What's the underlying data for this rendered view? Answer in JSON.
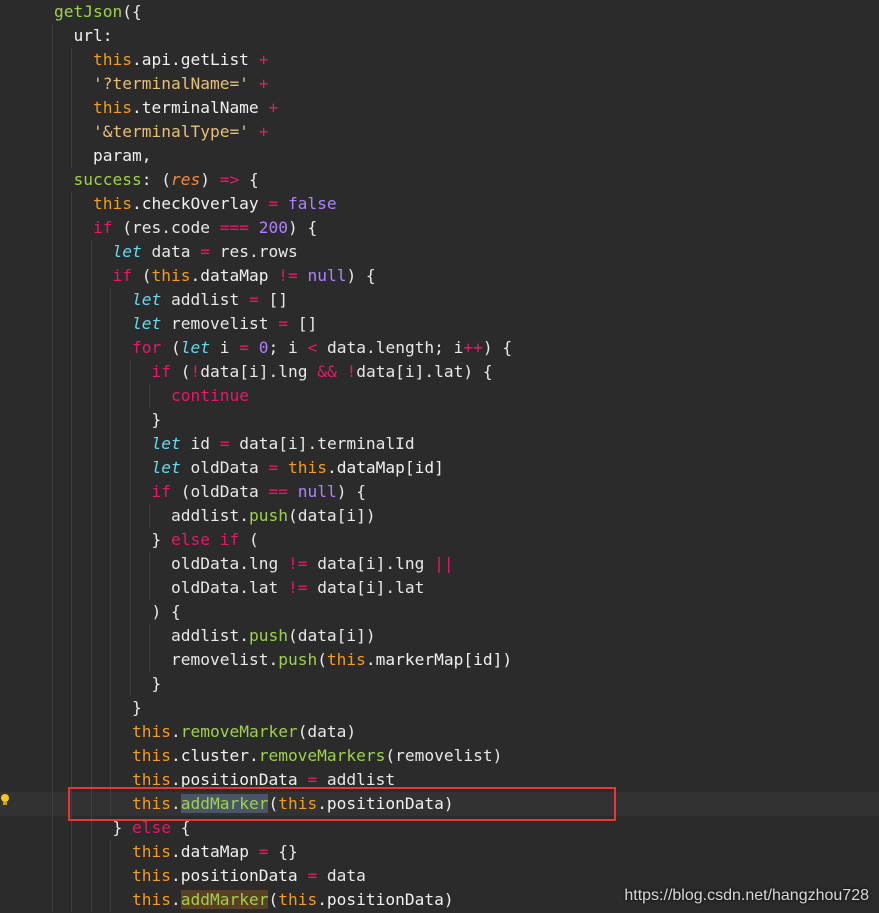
{
  "code_lines": [
    {
      "indent": 1,
      "tokens": [
        [
          "fn",
          "getJson"
        ],
        [
          "plain",
          "({"
        ]
      ]
    },
    {
      "indent": 2,
      "tokens": [
        [
          "prop",
          "url:"
        ]
      ]
    },
    {
      "indent": 3,
      "tokens": [
        [
          "obj",
          "this"
        ],
        [
          "prop",
          ".api.getList "
        ],
        [
          "op",
          "+"
        ]
      ]
    },
    {
      "indent": 3,
      "tokens": [
        [
          "str",
          "'?terminalName='"
        ],
        [
          "plain",
          " "
        ],
        [
          "op",
          "+"
        ]
      ]
    },
    {
      "indent": 3,
      "tokens": [
        [
          "obj",
          "this"
        ],
        [
          "prop",
          ".terminalName "
        ],
        [
          "op",
          "+"
        ]
      ]
    },
    {
      "indent": 3,
      "tokens": [
        [
          "str",
          "'&terminalType='"
        ],
        [
          "plain",
          " "
        ],
        [
          "op",
          "+"
        ]
      ]
    },
    {
      "indent": 3,
      "tokens": [
        [
          "prop",
          "param,"
        ]
      ]
    },
    {
      "indent": 2,
      "tokens": [
        [
          "fn",
          "success"
        ],
        [
          "plain",
          ": ("
        ],
        [
          "arg",
          "res"
        ],
        [
          "plain",
          ") "
        ],
        [
          "op",
          "=>"
        ],
        [
          "plain",
          " {"
        ]
      ]
    },
    {
      "indent": 3,
      "tokens": [
        [
          "obj",
          "this"
        ],
        [
          "prop",
          ".checkOverlay "
        ],
        [
          "op",
          "="
        ],
        [
          "plain",
          " "
        ],
        [
          "bool",
          "false"
        ]
      ]
    },
    {
      "indent": 3,
      "tokens": [
        [
          "kw",
          "if"
        ],
        [
          "plain",
          " (res.code "
        ],
        [
          "op",
          "==="
        ],
        [
          "plain",
          " "
        ],
        [
          "num",
          "200"
        ],
        [
          "plain",
          ") {"
        ]
      ]
    },
    {
      "indent": 4,
      "tokens": [
        [
          "let",
          "let"
        ],
        [
          "plain",
          " data "
        ],
        [
          "op",
          "="
        ],
        [
          "plain",
          " res.rows"
        ]
      ]
    },
    {
      "indent": 4,
      "tokens": [
        [
          "kw",
          "if"
        ],
        [
          "plain",
          " ("
        ],
        [
          "obj",
          "this"
        ],
        [
          "prop",
          ".dataMap "
        ],
        [
          "op",
          "!="
        ],
        [
          "plain",
          " "
        ],
        [
          "bool",
          "null"
        ],
        [
          "plain",
          ") {"
        ]
      ]
    },
    {
      "indent": 5,
      "tokens": [
        [
          "let",
          "let"
        ],
        [
          "plain",
          " addlist "
        ],
        [
          "op",
          "="
        ],
        [
          "plain",
          " []"
        ]
      ]
    },
    {
      "indent": 5,
      "tokens": [
        [
          "let",
          "let"
        ],
        [
          "plain",
          " removelist "
        ],
        [
          "op",
          "="
        ],
        [
          "plain",
          " []"
        ]
      ]
    },
    {
      "indent": 5,
      "tokens": [
        [
          "kw",
          "for"
        ],
        [
          "plain",
          " ("
        ],
        [
          "let",
          "let"
        ],
        [
          "plain",
          " i "
        ],
        [
          "op",
          "="
        ],
        [
          "plain",
          " "
        ],
        [
          "num",
          "0"
        ],
        [
          "plain",
          "; i "
        ],
        [
          "op",
          "<"
        ],
        [
          "plain",
          " data.length; i"
        ],
        [
          "op",
          "++"
        ],
        [
          "plain",
          ") {"
        ]
      ]
    },
    {
      "indent": 6,
      "tokens": [
        [
          "kw",
          "if"
        ],
        [
          "plain",
          " ("
        ],
        [
          "op",
          "!"
        ],
        [
          "plain",
          "data[i].lng "
        ],
        [
          "op",
          "&&"
        ],
        [
          "plain",
          " "
        ],
        [
          "op",
          "!"
        ],
        [
          "plain",
          "data[i].lat) {"
        ]
      ]
    },
    {
      "indent": 7,
      "tokens": [
        [
          "kw",
          "continue"
        ]
      ]
    },
    {
      "indent": 6,
      "tokens": [
        [
          "plain",
          "}"
        ]
      ]
    },
    {
      "indent": 6,
      "tokens": [
        [
          "let",
          "let"
        ],
        [
          "plain",
          " id "
        ],
        [
          "op",
          "="
        ],
        [
          "plain",
          " data[i].terminalId"
        ]
      ]
    },
    {
      "indent": 6,
      "tokens": [
        [
          "let",
          "let"
        ],
        [
          "plain",
          " oldData "
        ],
        [
          "op",
          "="
        ],
        [
          "plain",
          " "
        ],
        [
          "obj",
          "this"
        ],
        [
          "prop",
          ".dataMap[id]"
        ]
      ]
    },
    {
      "indent": 6,
      "tokens": [
        [
          "kw",
          "if"
        ],
        [
          "plain",
          " (oldData "
        ],
        [
          "op",
          "=="
        ],
        [
          "plain",
          " "
        ],
        [
          "bool",
          "null"
        ],
        [
          "plain",
          ") {"
        ]
      ]
    },
    {
      "indent": 7,
      "tokens": [
        [
          "plain",
          "addlist."
        ],
        [
          "fn",
          "push"
        ],
        [
          "plain",
          "(data[i])"
        ]
      ]
    },
    {
      "indent": 6,
      "tokens": [
        [
          "plain",
          "} "
        ],
        [
          "kw",
          "else if"
        ],
        [
          "plain",
          " ("
        ]
      ]
    },
    {
      "indent": 7,
      "tokens": [
        [
          "plain",
          "oldData.lng "
        ],
        [
          "op",
          "!="
        ],
        [
          "plain",
          " data[i].lng "
        ],
        [
          "op",
          "||"
        ]
      ]
    },
    {
      "indent": 7,
      "tokens": [
        [
          "plain",
          "oldData.lat "
        ],
        [
          "op",
          "!="
        ],
        [
          "plain",
          " data[i].lat"
        ]
      ]
    },
    {
      "indent": 6,
      "tokens": [
        [
          "plain",
          ") {"
        ]
      ]
    },
    {
      "indent": 7,
      "tokens": [
        [
          "plain",
          "addlist."
        ],
        [
          "fn",
          "push"
        ],
        [
          "plain",
          "(data[i])"
        ]
      ]
    },
    {
      "indent": 7,
      "tokens": [
        [
          "plain",
          "removelist."
        ],
        [
          "fn",
          "push"
        ],
        [
          "plain",
          "("
        ],
        [
          "obj",
          "this"
        ],
        [
          "prop",
          ".markerMap[id])"
        ]
      ]
    },
    {
      "indent": 6,
      "tokens": [
        [
          "plain",
          "}"
        ]
      ]
    },
    {
      "indent": 5,
      "tokens": [
        [
          "plain",
          "}"
        ]
      ]
    },
    {
      "indent": 5,
      "tokens": [
        [
          "obj",
          "this"
        ],
        [
          "plain",
          "."
        ],
        [
          "fn",
          "removeMarker"
        ],
        [
          "plain",
          "(data)"
        ]
      ]
    },
    {
      "indent": 5,
      "tokens": [
        [
          "obj",
          "this"
        ],
        [
          "prop",
          ".cluster."
        ],
        [
          "fn",
          "removeMarkers"
        ],
        [
          "plain",
          "(removelist)"
        ]
      ]
    },
    {
      "indent": 5,
      "tokens": [
        [
          "obj",
          "this"
        ],
        [
          "prop",
          ".positionData "
        ],
        [
          "op",
          "="
        ],
        [
          "plain",
          " addlist"
        ]
      ]
    },
    {
      "indent": 5,
      "current": true,
      "tokens": [
        [
          "obj",
          "this"
        ],
        [
          "plain",
          "."
        ],
        [
          "fn-hl",
          "addMarker"
        ],
        [
          "plain",
          "("
        ],
        [
          "obj",
          "this"
        ],
        [
          "prop",
          ".positionData)"
        ]
      ]
    },
    {
      "indent": 4,
      "tokens": [
        [
          "plain",
          "} "
        ],
        [
          "kw",
          "else"
        ],
        [
          "plain",
          " {"
        ]
      ]
    },
    {
      "indent": 5,
      "tokens": [
        [
          "obj",
          "this"
        ],
        [
          "prop",
          ".dataMap "
        ],
        [
          "op",
          "="
        ],
        [
          "plain",
          " {}"
        ]
      ]
    },
    {
      "indent": 5,
      "tokens": [
        [
          "obj",
          "this"
        ],
        [
          "prop",
          ".positionData "
        ],
        [
          "op",
          "="
        ],
        [
          "plain",
          " data"
        ]
      ]
    },
    {
      "indent": 5,
      "tokens": [
        [
          "obj",
          "this"
        ],
        [
          "plain",
          "."
        ],
        [
          "fn-hl2",
          "addMarker"
        ],
        [
          "plain",
          "("
        ],
        [
          "obj",
          "this"
        ],
        [
          "prop",
          ".positionData)"
        ]
      ]
    }
  ],
  "watermark": "https://blog.csdn.net/hangzhou728",
  "colors": {
    "background": "#2b2b2b",
    "highlight_box": "#e53935",
    "function": "#9fd14d",
    "keyword": "#e5186a",
    "this": "#f29c1f",
    "string": "#e6c07b",
    "number": "#ae81ff",
    "let": "#66d9ef"
  },
  "icons": {
    "gutter_hint": "lightbulb-icon"
  }
}
